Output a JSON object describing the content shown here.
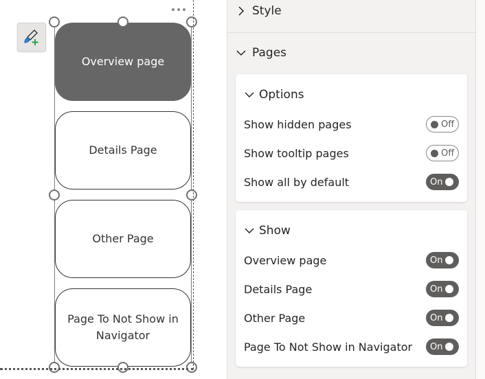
{
  "canvas": {
    "nav_buttons": [
      {
        "label": "Overview page",
        "active": true
      },
      {
        "label": "Details Page",
        "active": false
      },
      {
        "label": "Other Page",
        "active": false
      },
      {
        "label": "Page To Not Show in Navigator",
        "active": false
      }
    ],
    "icons": {
      "format": "format-painter-add-icon",
      "more": "more-options-icon"
    }
  },
  "pane": {
    "style_section": {
      "label": "Style",
      "expanded": false
    },
    "pages_section": {
      "label": "Pages",
      "expanded": true
    },
    "options_card": {
      "title": "Options",
      "rows": [
        {
          "label": "Show hidden pages",
          "state": "Off"
        },
        {
          "label": "Show tooltip pages",
          "state": "Off"
        },
        {
          "label": "Show all by default",
          "state": "On"
        }
      ]
    },
    "show_card": {
      "title": "Show",
      "rows": [
        {
          "label": "Overview page",
          "state": "On"
        },
        {
          "label": "Details Page",
          "state": "On"
        },
        {
          "label": "Other Page",
          "state": "On"
        },
        {
          "label": "Page To Not Show in Navigator",
          "state": "On"
        }
      ]
    }
  },
  "colors": {
    "active_button": "#666666",
    "toggle_on": "#605e5c",
    "pane_bg": "#f3f2f1"
  }
}
